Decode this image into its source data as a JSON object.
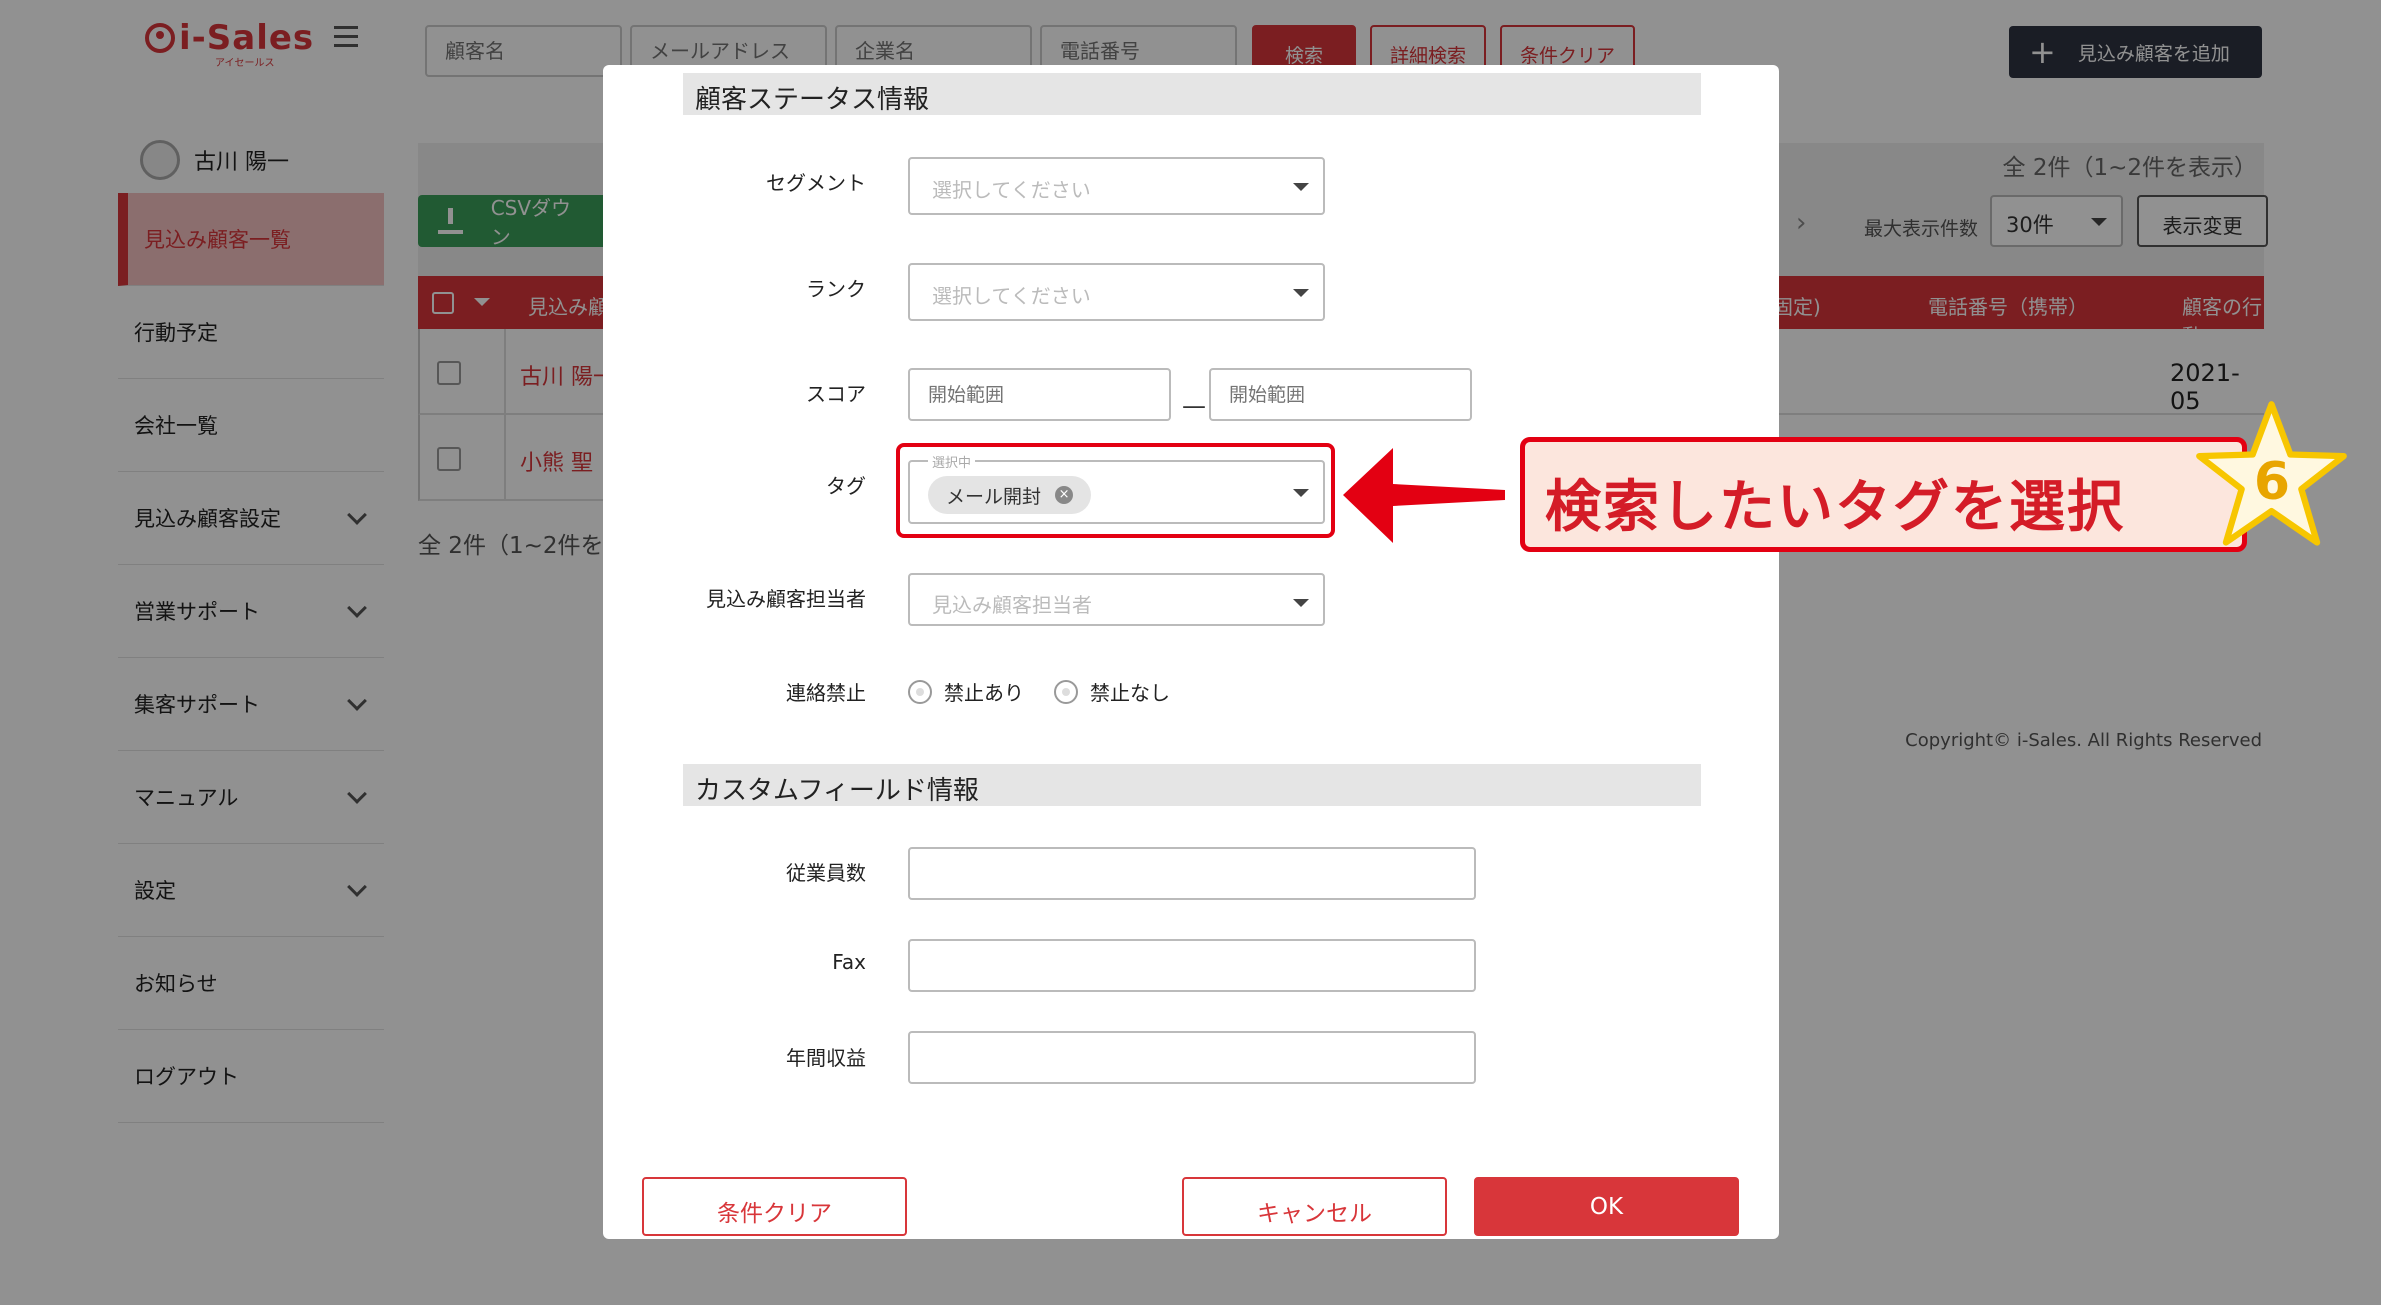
{
  "app": {
    "logo_text": "i-Sales",
    "logo_sub": "アイセールス",
    "search_placeholders": [
      "顧客名",
      "メールアドレス",
      "企業名",
      "電話番号"
    ],
    "search_button": "検索",
    "detail_search_button": "詳細検索",
    "clear_button": "条件クリア",
    "add_button": "見込み顧客を追加",
    "user_name": "古川 陽一",
    "sidebar": [
      {
        "label": "見込み顧客一覧",
        "active": true
      },
      {
        "label": "行動予定"
      },
      {
        "label": "会社一覧"
      },
      {
        "label": "見込み顧客設定",
        "expandable": true
      },
      {
        "label": "営業サポート",
        "expandable": true
      },
      {
        "label": "集客サポート",
        "expandable": true
      },
      {
        "label": "マニュアル",
        "expandable": true
      },
      {
        "label": "設定",
        "expandable": true
      },
      {
        "label": "お知らせ"
      },
      {
        "label": "ログアウト"
      }
    ],
    "total_top": "全 2件（1~2件を表示）",
    "csv_button": "CSVダウン",
    "max_label": "最大表示件数",
    "max_value": "30件",
    "change_button": "表示変更",
    "table_headers": [
      "見込み顧",
      "固定)",
      "電話番号（携帯）",
      "顧客の行動"
    ],
    "rows": [
      {
        "name": "古川 陽一",
        "date": "2021-05"
      },
      {
        "name": "小熊 聖"
      }
    ],
    "total_bottom": "全 2件（1~2件を",
    "copyright": "Copyright© i-Sales. All Rights Reserved"
  },
  "modal": {
    "section_status": "顧客ステータス情報",
    "segment_label": "セグメント",
    "segment_placeholder": "選択してください",
    "rank_label": "ランク",
    "rank_placeholder": "選択してください",
    "score_label": "スコア",
    "score_from_placeholder": "開始範囲",
    "score_to_placeholder": "開始範囲",
    "score_dash": "—",
    "tag_label": "タグ",
    "tag_legend": "選択中",
    "tag_chip": "メール開封",
    "owner_label": "見込み顧客担当者",
    "owner_placeholder": "見込み顧客担当者",
    "contact_label": "連絡禁止",
    "contact_options": [
      "禁止あり",
      "禁止なし"
    ],
    "section_custom": "カスタムフィールド情報",
    "employees_label": "従業員数",
    "fax_label": "Fax",
    "revenue_label": "年間収益",
    "clear_button": "条件クリア",
    "cancel_button": "キャンセル",
    "ok_button": "OK"
  },
  "callout": {
    "text": "検索したいタグを選択",
    "step": "6",
    "color": "#e30012"
  }
}
